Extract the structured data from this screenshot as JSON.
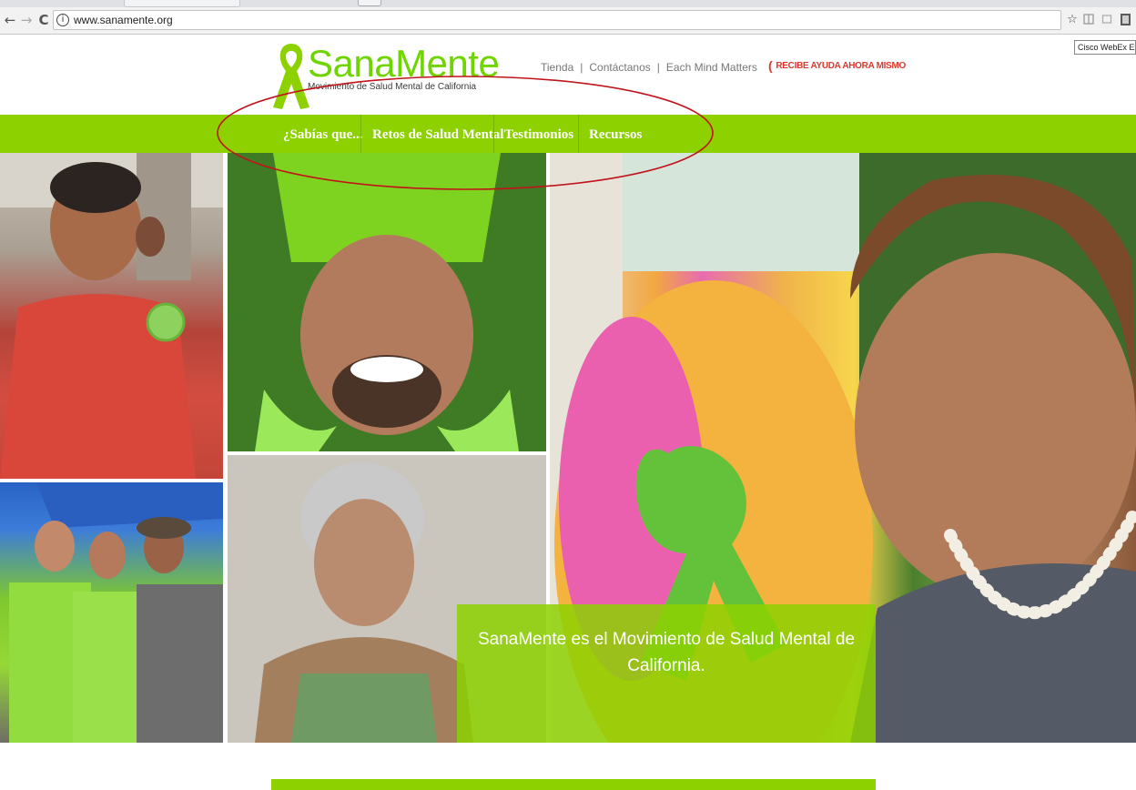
{
  "browser": {
    "back_icon": "←",
    "forward_icon": "→",
    "reload_icon": "C",
    "info_icon": "i",
    "url": "www.sanamente.org",
    "star_icon": "☆",
    "tooltip": "Cisco WebEx Exte"
  },
  "header": {
    "logo_text": "SanaMente",
    "logo_tagline": "Movimiento de Salud Mental de California",
    "links": [
      "Tienda",
      "Contáctanos",
      "Each Mind Matters"
    ],
    "separator": "|",
    "help_icon": "(",
    "help_text": "RECIBE AYUDA AHORA MISMO"
  },
  "nav": {
    "items": [
      "¿Sabías que...",
      "Retos de Salud Mental",
      "Testimonios",
      "Recursos"
    ]
  },
  "hero": {
    "caption": "SanaMente es el Movimiento de Salud Mental de California."
  },
  "colors": {
    "brand_green": "#8dd101",
    "logo_green": "#6fd500",
    "alert_red": "#d93a2f",
    "annotation_red": "#c0141b"
  }
}
